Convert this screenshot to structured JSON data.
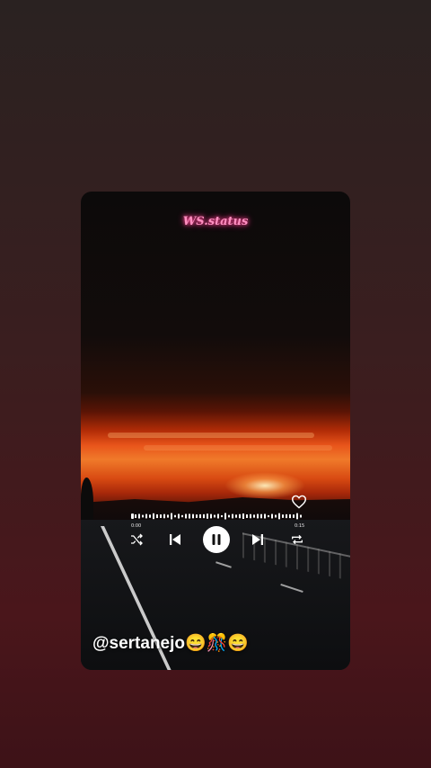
{
  "watermark": "WS.status",
  "player": {
    "time_elapsed": "0:00",
    "time_total": "0:15",
    "progress": 0.0,
    "liked": false,
    "state": "playing"
  },
  "caption": "@sertanejo😄🎊😄",
  "icons": {
    "like": "heart-icon",
    "shuffle": "shuffle-icon",
    "previous": "skip-previous-icon",
    "play_pause": "pause-icon",
    "next": "skip-next-icon",
    "repeat": "repeat-icon"
  },
  "colors": {
    "watermark": "#ff8fc0",
    "controls": "#ffffff"
  }
}
